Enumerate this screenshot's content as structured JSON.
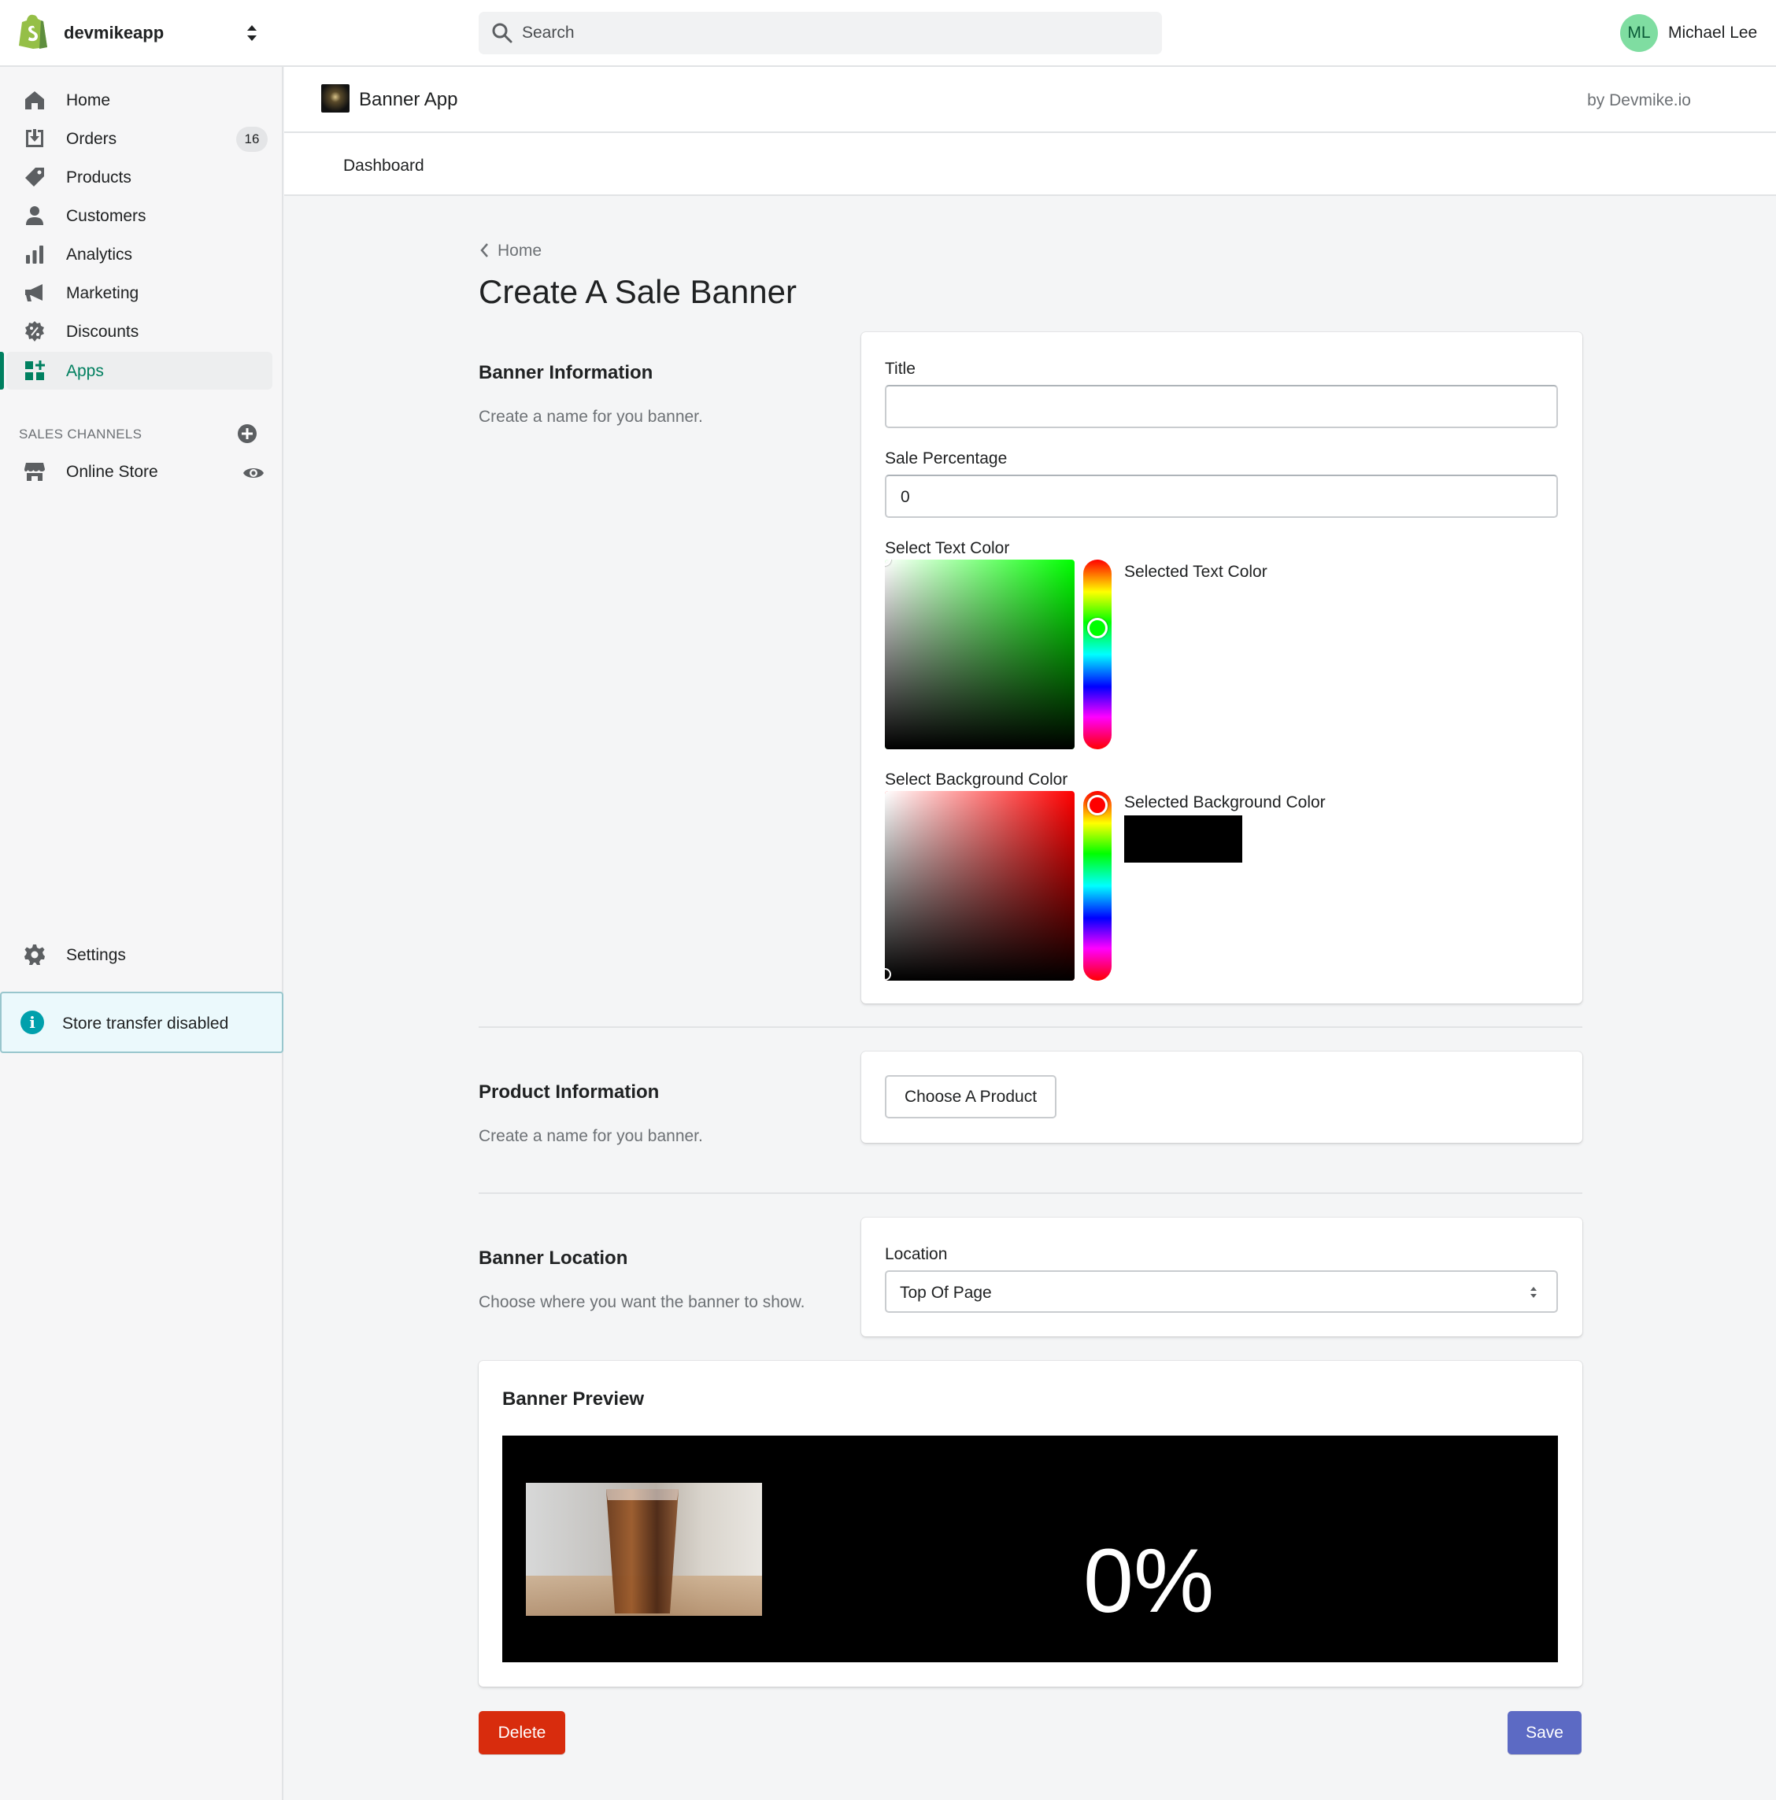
{
  "topbar": {
    "store_name": "devmikeapp",
    "search_placeholder": "Search",
    "avatar_initials": "ML",
    "user_name": "Michael Lee"
  },
  "sidebar": {
    "items": [
      {
        "label": "Home",
        "icon": "home-icon"
      },
      {
        "label": "Orders",
        "icon": "orders-icon",
        "badge": "16"
      },
      {
        "label": "Products",
        "icon": "tag-icon"
      },
      {
        "label": "Customers",
        "icon": "person-icon"
      },
      {
        "label": "Analytics",
        "icon": "bar-chart-icon"
      },
      {
        "label": "Marketing",
        "icon": "megaphone-icon"
      },
      {
        "label": "Discounts",
        "icon": "discount-icon"
      },
      {
        "label": "Apps",
        "icon": "apps-icon",
        "active": true
      }
    ],
    "sales_channels_label": "SALES CHANNELS",
    "online_store_label": "Online Store",
    "settings_label": "Settings",
    "store_transfer_notice": "Store transfer disabled"
  },
  "app": {
    "name": "Banner App",
    "by": "by Devmike.io",
    "tab_dashboard": "Dashboard"
  },
  "page": {
    "breadcrumb": "Home",
    "title": "Create A Sale Banner"
  },
  "banner_info": {
    "title": "Banner Information",
    "description": "Create a name for you banner.",
    "title_label": "Title",
    "title_value": "",
    "sale_label": "Sale Percentage",
    "sale_value": "0",
    "text_color_label": "Select Text Color",
    "selected_text_color_label": "Selected Text Color",
    "bg_color_label": "Select Background Color",
    "selected_bg_color_label": "Selected Background Color",
    "text_picker_hue_color": "#00ff00",
    "bg_picker_hue_color": "#ff0000",
    "selected_bg_color": "#000000"
  },
  "product_info": {
    "title": "Product Information",
    "description": "Create a name for you banner.",
    "choose_label": "Choose A Product"
  },
  "banner_location": {
    "title": "Banner Location",
    "description": "Choose where you want the banner to show.",
    "location_label": "Location",
    "location_value": "Top Of Page"
  },
  "preview": {
    "title": "Banner Preview",
    "percentage_text": "0%"
  },
  "actions": {
    "delete_label": "Delete",
    "save_label": "Save"
  }
}
